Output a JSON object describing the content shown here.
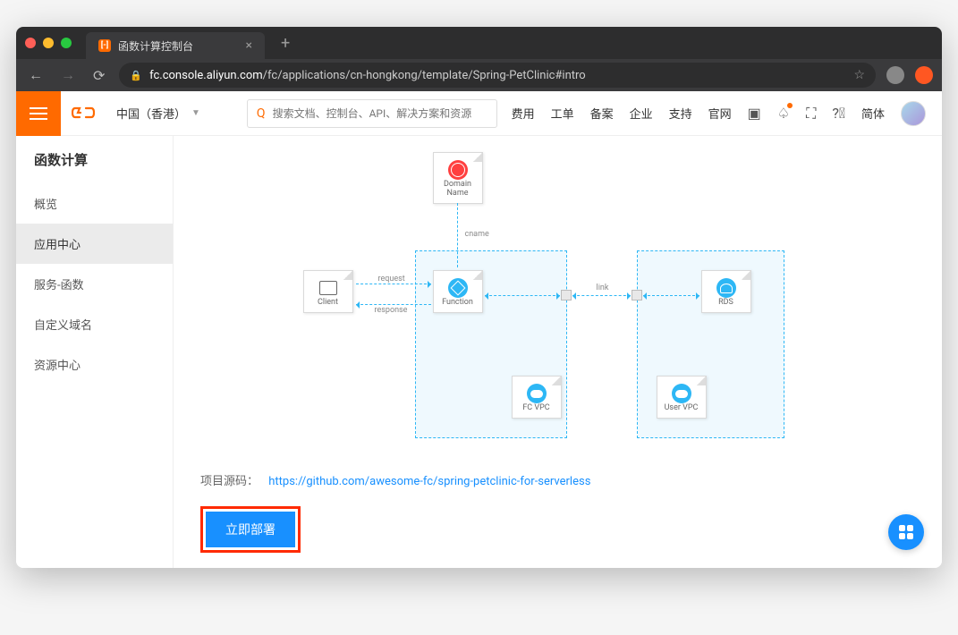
{
  "browser": {
    "tab": {
      "title": "函数计算控制台"
    },
    "url": {
      "domain": "fc.console.aliyun.com",
      "path": "/fc/applications/cn-hongkong/template/Spring-PetClinic#intro"
    }
  },
  "header": {
    "region": "中国（香港）",
    "searchPlaceholder": "搜索文档、控制台、API、解决方案和资源",
    "nav": {
      "fee": "费用",
      "ticket": "工单",
      "beian": "备案",
      "enterprise": "企业",
      "support": "支持",
      "official": "官网",
      "lang": "简体"
    }
  },
  "sidebar": {
    "title": "函数计算",
    "items": [
      {
        "label": "概览"
      },
      {
        "label": "应用中心"
      },
      {
        "label": "服务-函数"
      },
      {
        "label": "自定义域名"
      },
      {
        "label": "资源中心"
      }
    ]
  },
  "diagram": {
    "nodes": {
      "domain": "Domain Name",
      "client": "Client",
      "function": "Function",
      "rds": "RDS",
      "fcvpc": "FC VPC",
      "uservpc": "User VPC"
    },
    "labels": {
      "cname": "cname",
      "request": "request",
      "response": "response",
      "link": "link"
    }
  },
  "source": {
    "label": "项目源码：",
    "link": "https://github.com/awesome-fc/spring-petclinic-for-serverless"
  },
  "deployButton": "立即部署"
}
